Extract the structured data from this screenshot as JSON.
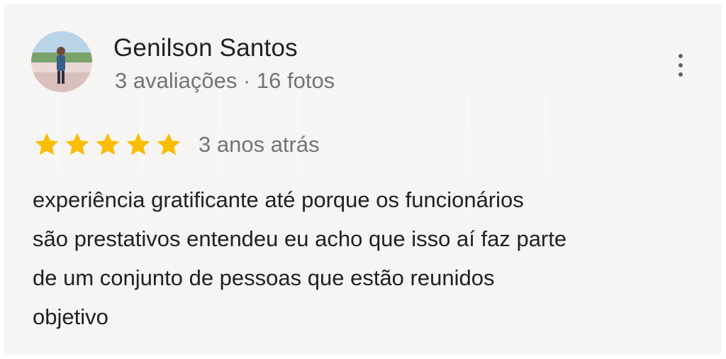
{
  "review": {
    "author_name": "Genilson Santos",
    "author_meta": "3 avaliações · 16 fotos",
    "rating": 5,
    "rating_max": 5,
    "date": "3 anos atrás",
    "text_lines": [
      "experiência gratificante até porque os funcionários",
      "são prestativos entendeu eu acho que isso aí faz parte",
      "de um conjunto de pessoas que estão reunidos",
      "objetivo"
    ]
  },
  "icons": {
    "avatar": "user-photo-avatar",
    "menu": "more-vert-icon",
    "star": "star-icon"
  },
  "colors": {
    "background": "#f6f5f3",
    "star": "#fbbc04",
    "name": "#202124",
    "secondary": "#70757a"
  }
}
